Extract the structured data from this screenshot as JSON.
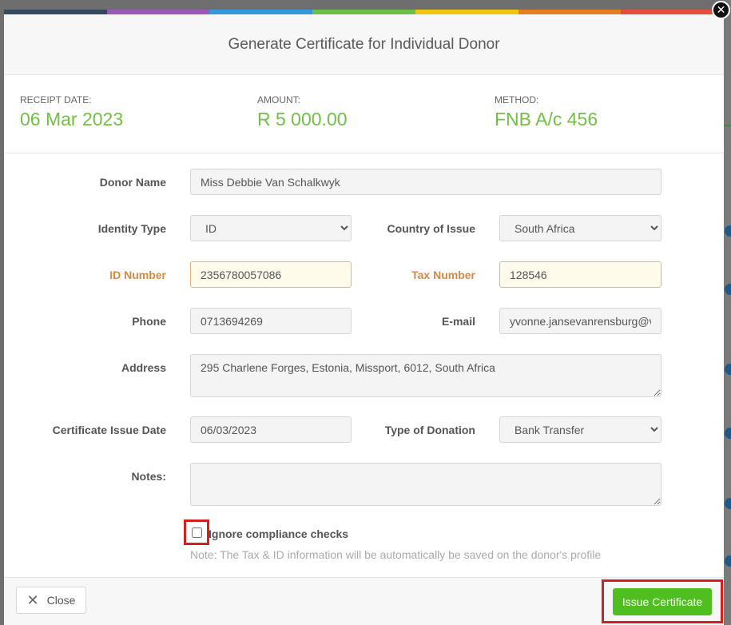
{
  "modal": {
    "title": "Generate Certificate for Individual Donor",
    "topbar_colors": [
      "#34495e",
      "#9b59b6",
      "#3498db",
      "#6cc04a",
      "#f1c40f",
      "#e67e22",
      "#e74c3c"
    ]
  },
  "summary": {
    "receipt_date_label": "RECEIPT DATE:",
    "receipt_date": "06 Mar 2023",
    "amount_label": "AMOUNT:",
    "amount": "R 5 000.00",
    "method_label": "METHOD:",
    "method": "FNB A/c 456"
  },
  "form": {
    "donor_name_label": "Donor Name",
    "donor_name": "Miss Debbie Van Schalkwyk",
    "identity_type_label": "Identity Type",
    "identity_type": "ID",
    "country_label": "Country of Issue",
    "country": "South Africa",
    "id_number_label": "ID Number",
    "id_number": "2356780057086",
    "tax_number_label": "Tax Number",
    "tax_number": "128546",
    "phone_label": "Phone",
    "phone": "0713694269",
    "email_label": "E-mail",
    "email": "yvonne.jansevanrensburg@v",
    "address_label": "Address",
    "address": "295 Charlene Forges, Estonia, Missport, 6012, South Africa",
    "issue_date_label": "Certificate Issue Date",
    "issue_date": "06/03/2023",
    "donation_type_label": "Type of Donation",
    "donation_type": "Bank Transfer",
    "notes_label": "Notes:",
    "notes": "",
    "ignore_label": "Ignore compliance checks",
    "note_text": "Note: The Tax & ID information will be automatically be saved on the donor's profile"
  },
  "footer": {
    "close_label": "Close",
    "issue_label": "Issue Certificate"
  },
  "colors": {
    "accent_green": "#72c043",
    "warn_orange": "#d08a47",
    "highlight_red": "#d22020"
  }
}
